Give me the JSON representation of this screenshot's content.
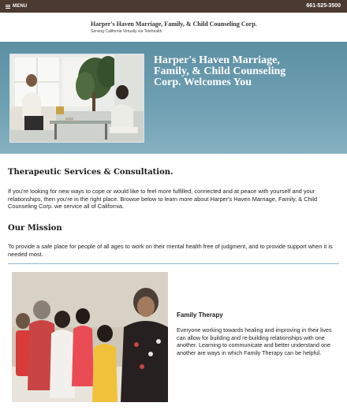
{
  "topbar": {
    "menu_label": "MENU",
    "phone": "661-525-3500"
  },
  "header": {
    "brand": "Harper's Haven Marriage, Family, & Child Counseling Corp.",
    "tagline": "Serving California Virtually via Telehealth"
  },
  "hero": {
    "title": "Harper's Haven Marriage, Family, & Child Counseling Corp. Welcomes You"
  },
  "services": {
    "title": "Therapeutic Services & Consultation.",
    "intro": "If you're looking for new ways to cope or would like to feel more fulfilled, connected and at peace with yourself and your relationships, then you're in the right place. Browse below to learn more about Harper's Haven Marriage, Family, & Child Counseling Corp. we service all of California."
  },
  "mission": {
    "title": "Our Mission",
    "text": "To provide a safe place for people of all ages to work on their mental health free of judgment, and to provide support when it is needed most."
  },
  "family_therapy": {
    "title": "Family Therapy",
    "text": "Everyone working towards healing and improving in their lives can allow for building and re-building relationships with one another. Learning to communicate and better understand one another are ways in which Family Therapy can be helpful."
  },
  "icons": {
    "menu": "hamburger-icon"
  },
  "colors": {
    "topbar": "#4a3a30",
    "hero": "#6e9fb2",
    "divider": "#8fb8c8"
  }
}
